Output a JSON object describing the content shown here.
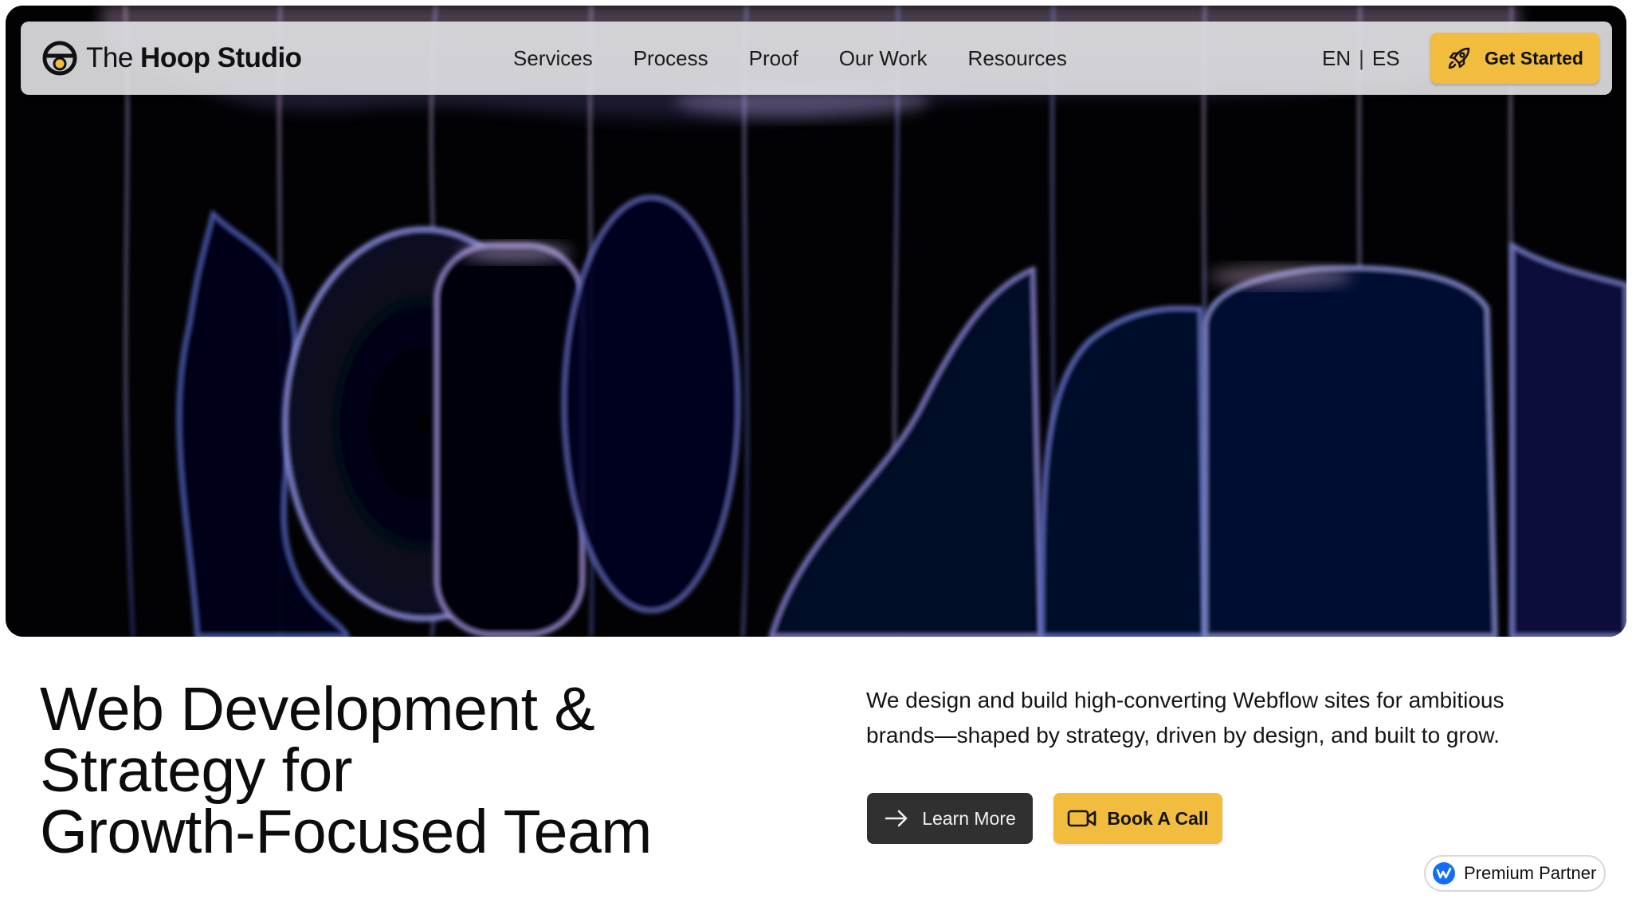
{
  "brand": {
    "name_light": "The",
    "name_bold": "Hoop Studio",
    "logo_icon": "hoop-logo-icon",
    "accent": "#f2bd3e"
  },
  "nav": {
    "items": [
      {
        "label": "Services"
      },
      {
        "label": "Process"
      },
      {
        "label": "Proof"
      },
      {
        "label": "Our Work"
      },
      {
        "label": "Resources"
      }
    ]
  },
  "language": {
    "current": "EN",
    "separator": "|",
    "alternate": "ES"
  },
  "header_cta": {
    "label": "Get Started",
    "icon": "rocket-icon"
  },
  "hero": {
    "headline_lines": [
      "Web Development &",
      "Strategy for",
      "Growth-Focused Team"
    ],
    "description": "We design and build high-converting Webflow sites for ambitious brands—shaped by strategy, driven by design, and built to grow.",
    "primary_button": {
      "label": "Learn More",
      "icon": "arrow-right-icon",
      "color": "#303030"
    },
    "secondary_button": {
      "label": "Book A Call",
      "icon": "video-camera-icon",
      "color": "#f2bd3e"
    }
  },
  "badge": {
    "label": "Premium Partner",
    "icon": "webflow-icon",
    "icon_color": "#146ef5"
  }
}
